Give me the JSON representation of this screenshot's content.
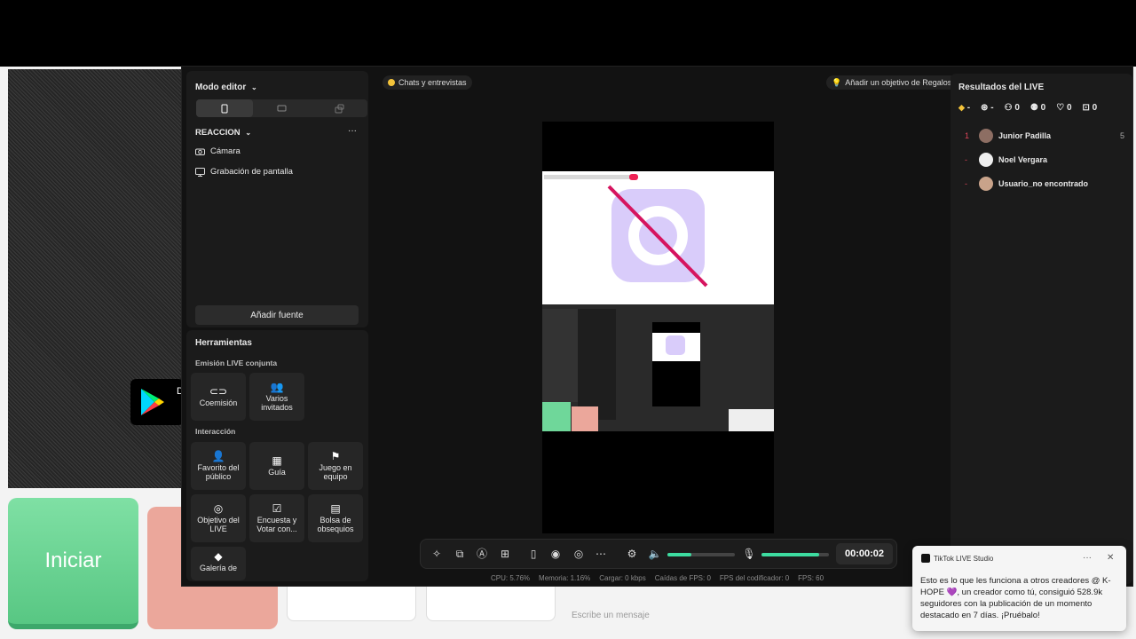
{
  "background_app": {
    "start_button_label": "Iniciar",
    "message_placeholder": "Escribe un mensaje",
    "store_badge_letter": "D"
  },
  "left_panel": {
    "mode_label": "Modo editor",
    "scene_label": "REACCION",
    "more_label": "···",
    "sources": [
      {
        "label": "Cámara",
        "icon": "camera-icon"
      },
      {
        "label": "Grabación de pantalla",
        "icon": "monitor-icon"
      }
    ],
    "add_source_label": "Añadir fuente"
  },
  "tools": {
    "title": "Herramientas",
    "section_multi": "Emisión LIVE conjunta",
    "multi_items": [
      {
        "label": "Coemisión",
        "icon": "link-icon"
      },
      {
        "label": "Varios invitados",
        "icon": "people-icon"
      }
    ],
    "section_interaction": "Interacción",
    "interaction_items": [
      {
        "label": "Favorito del público",
        "icon": "fans-icon"
      },
      {
        "label": "Guía",
        "icon": "guide-icon"
      },
      {
        "label": "Juego en equipo",
        "icon": "team-game-icon"
      },
      {
        "label": "Objetivo del LIVE",
        "icon": "target-icon"
      },
      {
        "label": "Encuesta y Votar con...",
        "icon": "poll-icon"
      },
      {
        "label": "Bolsa de obsequios",
        "icon": "gift-bag-icon"
      },
      {
        "label": "Galería de",
        "icon": "gallery-icon"
      }
    ]
  },
  "center": {
    "chats_chip": "Chats y entrevistas",
    "goal_chip": "Añadir un objetivo de Regalos",
    "timer": "00:00:02",
    "stats": [
      "CPU: 5.76%",
      "Memoria: 1.16%",
      "Cargar: 0 kbps",
      "Caídas de FPS: 0",
      "FPS del codificador: 0",
      "FPS: 60"
    ],
    "speaker_level": 0.35,
    "mic_level": 0.85
  },
  "right_panel": {
    "title": "Resultados del LIVE",
    "counters": [
      "-",
      "-",
      "0",
      "0",
      "0",
      "0"
    ],
    "rows": [
      {
        "rank": "1",
        "name": "Junior Padilla",
        "score": "5"
      },
      {
        "rank": "-",
        "name": "Noel Vergara",
        "score": ""
      },
      {
        "rank": "-",
        "name": "Usuario_no encontrado",
        "score": ""
      }
    ]
  },
  "toast": {
    "app": "TikTok LIVE Studio",
    "more": "···",
    "close": "✕",
    "message": "Esto es lo que les funciona a otros creadores @ K-HOPE 💜, un creador como tú, consiguió 528.9k seguidores con la publicación de un momento destacado en 7 días. ¡Pruébalo!"
  },
  "colors": {
    "accent_green": "#3ddca0",
    "start_green": "#58c783",
    "rank_red": "#e0455a"
  }
}
